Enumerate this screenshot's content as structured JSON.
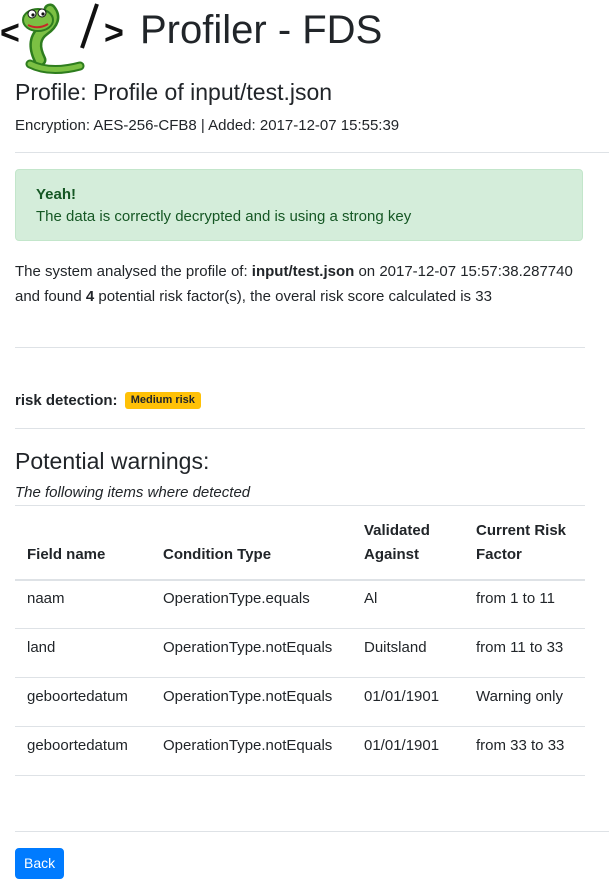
{
  "app": {
    "title": "Profiler - FDS"
  },
  "profile": {
    "title": "Profile: Profile of input/test.json",
    "meta": "Encryption: AES-256-CFB8 | Added: 2017-12-07 15:55:39"
  },
  "alert": {
    "heading": "Yeah!",
    "message": "The data is correctly decrypted and is using a strong key",
    "color": "#155724"
  },
  "summary": {
    "prefix": "The system analysed the profile of: ",
    "file": "input/test.json",
    "middle": " on 2017-12-07 15:57:38.287740 and found ",
    "count": "4",
    "suffix": " potential risk factor(s), the overal risk score calculated is 33"
  },
  "risk": {
    "label": "risk detection:",
    "badge": "Medium risk",
    "badge_color": "#ffc107"
  },
  "warnings": {
    "title": "Potential warnings:",
    "subtitle": "The following items where detected",
    "columns": [
      "Field name",
      "Condition Type",
      "Validated Against",
      "Current Risk Factor"
    ],
    "rows": [
      [
        "naam",
        "OperationType.equals",
        "Al",
        "from 1 to 11"
      ],
      [
        "land",
        "OperationType.notEquals",
        "Duitsland",
        "from 11 to 33"
      ],
      [
        "geboortedatum",
        "OperationType.notEquals",
        "01/01/1901",
        "Warning only"
      ],
      [
        "geboortedatum",
        "OperationType.notEquals",
        "01/01/1901",
        "from 33 to 33"
      ]
    ]
  },
  "back_button": {
    "label": "Back",
    "color": "#007bff"
  },
  "icons": {
    "logo": "python-snake-logo-icon"
  }
}
